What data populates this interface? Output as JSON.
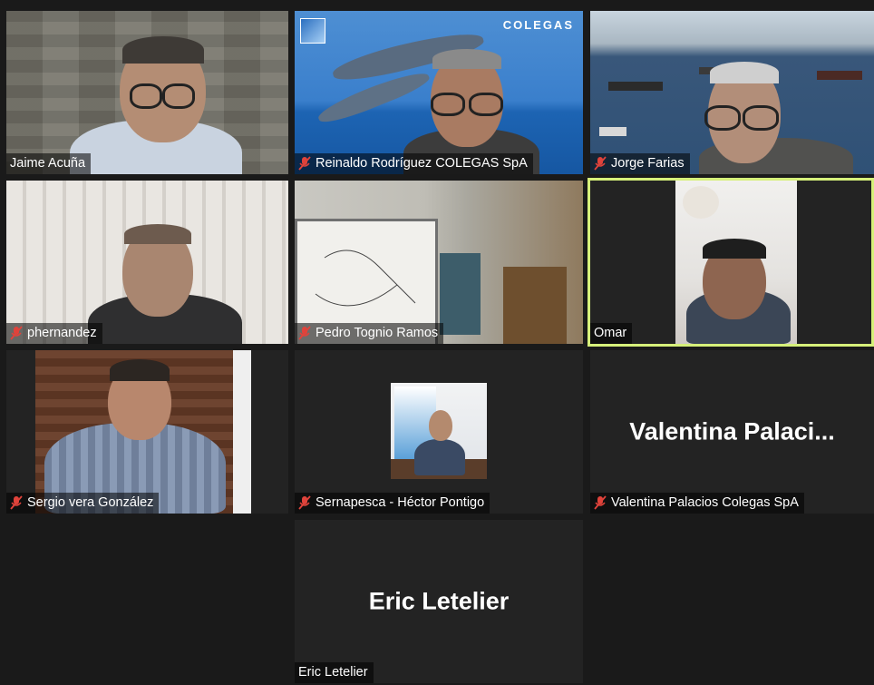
{
  "participants": [
    {
      "name": "Jaime Acuña",
      "muted": false
    },
    {
      "name": "Reinaldo Rodríguez  COLEGAS SpA",
      "muted": true
    },
    {
      "name": "Jorge Farias",
      "muted": true
    },
    {
      "name": "phernandez",
      "muted": true
    },
    {
      "name": "Pedro Tognio Ramos",
      "muted": true
    },
    {
      "name": "Omar",
      "muted": false,
      "active_speaker": true
    },
    {
      "name": "Sergio vera González",
      "muted": true
    },
    {
      "name": "Sernapesca - Héctor Pontigo",
      "muted": true
    },
    {
      "name": "Valentina Palacios Colegas SpA",
      "muted": true,
      "display_name_large": "Valentina  Palaci..."
    },
    {
      "name": "Eric Letelier",
      "muted": false,
      "display_name_large": "Eric Letelier"
    }
  ],
  "colegas_logo_text": "COLEGAS",
  "colors": {
    "active_border": "#d6f07a",
    "mute_red": "#e0433b"
  }
}
